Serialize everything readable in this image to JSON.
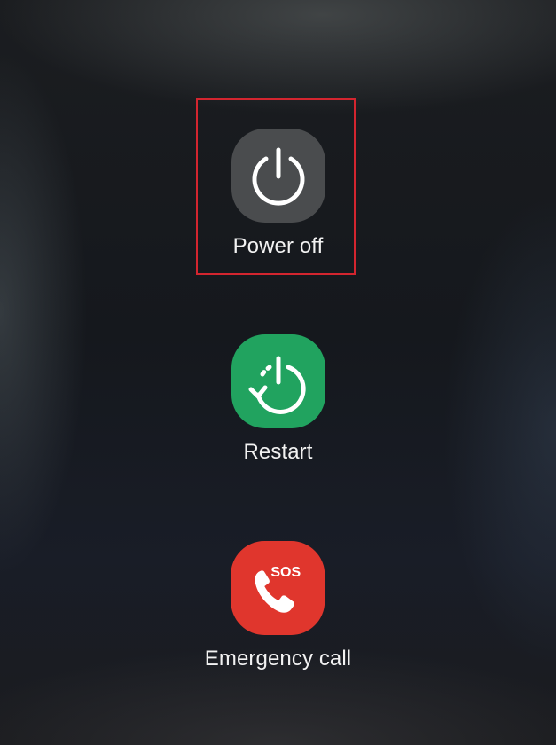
{
  "actions": [
    {
      "label": "Power off",
      "icon": "power-icon",
      "color": "#4a4c4e"
    },
    {
      "label": "Restart",
      "icon": "restart-icon",
      "color": "#21a35f"
    },
    {
      "label": "Emergency call",
      "icon": "sos-phone-icon",
      "color": "#e0362d",
      "badge": "SOS"
    }
  ],
  "highlight_color": "#d3252f"
}
